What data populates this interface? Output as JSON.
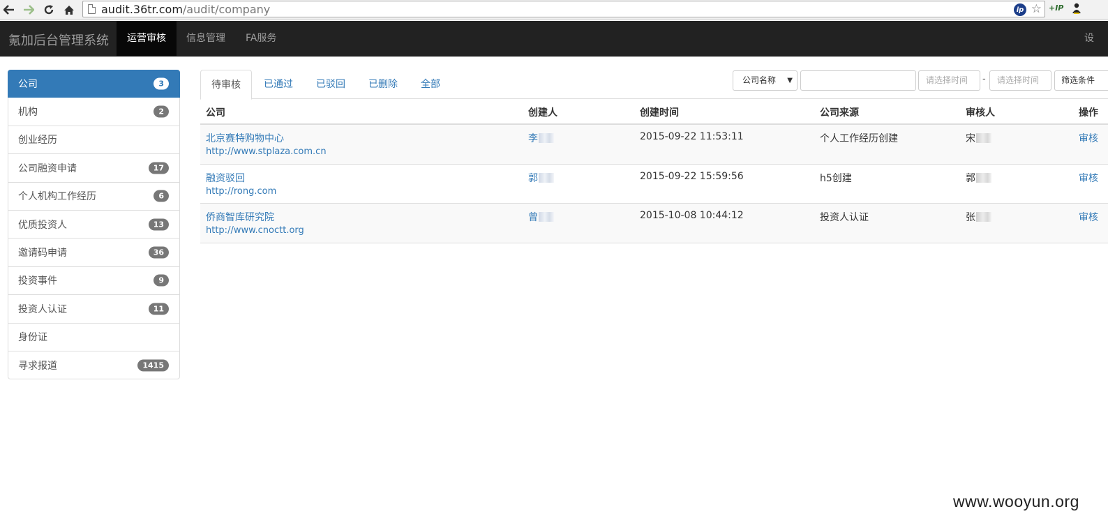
{
  "browser": {
    "url_host": "audit.36tr.com",
    "url_path": "/audit/company",
    "ip_badge": "ip",
    "ext_label": "+IP"
  },
  "navbar": {
    "brand": "氪加后台管理系统",
    "items": [
      {
        "label": "运营审核",
        "active": true
      },
      {
        "label": "信息管理"
      },
      {
        "label": "FA服务"
      }
    ],
    "right_label": "设"
  },
  "sidebar": {
    "items": [
      {
        "label": "公司",
        "badge": "3"
      },
      {
        "label": "机构",
        "badge": "2"
      },
      {
        "label": "创业经历",
        "badge": ""
      },
      {
        "label": "公司融资申请",
        "badge": "17"
      },
      {
        "label": "个人机构工作经历",
        "badge": "6"
      },
      {
        "label": "优质投资人",
        "badge": "13"
      },
      {
        "label": "邀请码申请",
        "badge": "36"
      },
      {
        "label": "投资事件",
        "badge": "9"
      },
      {
        "label": "投资人认证",
        "badge": "11"
      },
      {
        "label": "身份证",
        "badge": ""
      },
      {
        "label": "寻求报道",
        "badge": "1415"
      }
    ]
  },
  "tabs": [
    "待审核",
    "已通过",
    "已驳回",
    "已删除",
    "全部"
  ],
  "filters": {
    "select_value": "公司名称",
    "keyword_value": "",
    "start_placeholder": "请选择时间",
    "end_placeholder": "请选择时间",
    "separator": "-",
    "button_label": "筛选条件"
  },
  "table": {
    "headers": [
      "公司",
      "创建人",
      "创建时间",
      "公司来源",
      "审核人",
      "操作"
    ],
    "rows": [
      {
        "company": "北京赛特购物中心",
        "url": "http://www.stplaza.com.cn",
        "creator": "李",
        "created": "2015-09-22 11:53:11",
        "source": "个人工作经历创建",
        "reviewer": "宋",
        "action": "审核"
      },
      {
        "company": "融资驳回",
        "url": "http://rong.com",
        "creator": "郭",
        "created": "2015-09-22 15:59:56",
        "source": "h5创建",
        "reviewer": "郭",
        "action": "审核"
      },
      {
        "company": "侨商智库研究院",
        "url": "http://www.cnoctt.org",
        "creator": "曾",
        "created": "2015-10-08 10:44:12",
        "source": "投资人认证",
        "reviewer": "张",
        "action": "审核"
      }
    ]
  },
  "watermark": "www.wooyun.org"
}
